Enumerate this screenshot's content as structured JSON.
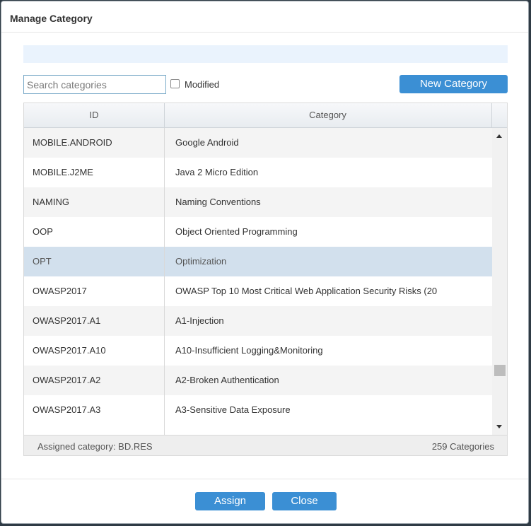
{
  "dialog": {
    "title": "Manage Category"
  },
  "toolbar": {
    "search_placeholder": "Search categories",
    "modified_label": "Modified",
    "modified_checked": false,
    "new_category_label": "New Category"
  },
  "table": {
    "headers": {
      "id": "ID",
      "category": "Category"
    },
    "rows": [
      {
        "id": "MOBILE.ANDROID",
        "category": "Google Android"
      },
      {
        "id": "MOBILE.J2ME",
        "category": "Java 2 Micro Edition"
      },
      {
        "id": "NAMING",
        "category": "Naming Conventions"
      },
      {
        "id": "OOP",
        "category": "Object Oriented Programming"
      },
      {
        "id": "OPT",
        "category": "Optimization",
        "selected": true
      },
      {
        "id": "OWASP2017",
        "category": "OWASP Top 10 Most Critical Web Application Security Risks (20"
      },
      {
        "id": "OWASP2017.A1",
        "category": "A1-Injection"
      },
      {
        "id": "OWASP2017.A10",
        "category": "A10-Insufficient Logging&Monitoring"
      },
      {
        "id": "OWASP2017.A2",
        "category": "A2-Broken Authentication"
      },
      {
        "id": "OWASP2017.A3",
        "category": "A3-Sensitive Data Exposure"
      }
    ],
    "footer": {
      "assigned": "Assigned category: BD.RES",
      "count": "259 Categories"
    }
  },
  "actions": {
    "assign_label": "Assign",
    "close_label": "Close"
  },
  "colors": {
    "accent": "#3b8fd4",
    "selected_row": "#d2e0ed",
    "info_bar": "#eaf3fd"
  }
}
